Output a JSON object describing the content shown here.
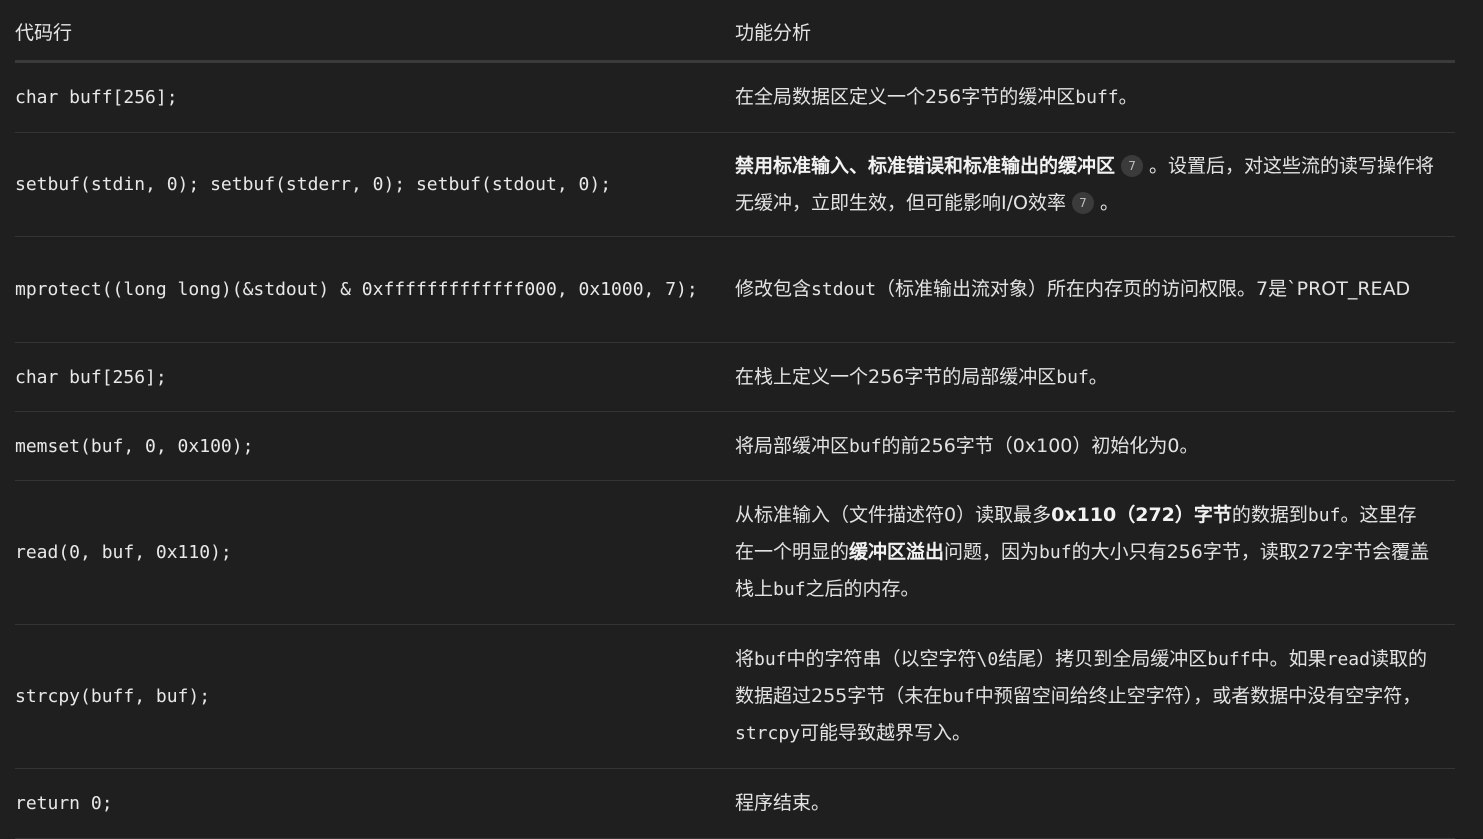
{
  "header": {
    "col1": "代码行",
    "col2": "功能分析"
  },
  "rows": [
    {
      "code": "char buff[256];",
      "desc": {
        "a": "在全局数据区定义一个256字节的缓冲区",
        "b": "buff",
        "c": "。"
      }
    },
    {
      "code": "setbuf(stdin, 0); setbuf(stderr, 0); setbuf(stdout, 0);",
      "desc": {
        "bold": "禁用标准输入、标准错误和标准输出的缓冲区",
        "cite1": "7",
        "a": "。设置后，对这些流的读写操作将无缓冲，立即生效，但可能影响I/O效率",
        "cite2": "7",
        "b": "。"
      }
    },
    {
      "code": "mprotect((long long)(&stdout) & 0xfffffffffffff000, 0x1000, 7);",
      "desc": {
        "a": "修改包含",
        "b": "stdout",
        "c": "（标准输出流对象）所在内存页的访问权限。7是`PROT_READ"
      }
    },
    {
      "code": "char buf[256];",
      "desc": {
        "a": "在栈上定义一个256字节的局部缓冲区",
        "b": "buf",
        "c": "。"
      }
    },
    {
      "code": "memset(buf, 0, 0x100);",
      "desc": {
        "a": "将局部缓冲区",
        "b": "buf",
        "c": "的前256字节（0x100）初始化为0。"
      }
    },
    {
      "code": "read(0, buf, 0x110);",
      "desc": {
        "a": "从标准输入（文件描述符0）读取最多",
        "bold1": "0x110（272）字节",
        "b": "的数据到",
        "c": "buf",
        "d": "。这里存在一个明显的",
        "bold2": "缓冲区溢出",
        "e": "问题，因为",
        "f": "buf",
        "g": "的大小只有256字节，读取272字节会覆盖栈上",
        "h": "buf",
        "i": "之后的内存。"
      }
    },
    {
      "code": "strcpy(buff, buf);",
      "desc": {
        "a": "将",
        "b": "buf",
        "c": "中的字符串（以空字符",
        "d": "\\0",
        "e": "结尾）拷贝到全局缓冲区",
        "f": "buff",
        "g": "中。如果",
        "h": "read",
        "i": "读取的数据超过255字节（未在",
        "j": "buf",
        "k": "中预留空间给终止空字符），或者数据中没有空字符，",
        "l": "strcpy",
        "m": "可能导致越界写入。"
      }
    },
    {
      "code": "return 0;",
      "desc": {
        "a": "程序结束。"
      }
    }
  ]
}
